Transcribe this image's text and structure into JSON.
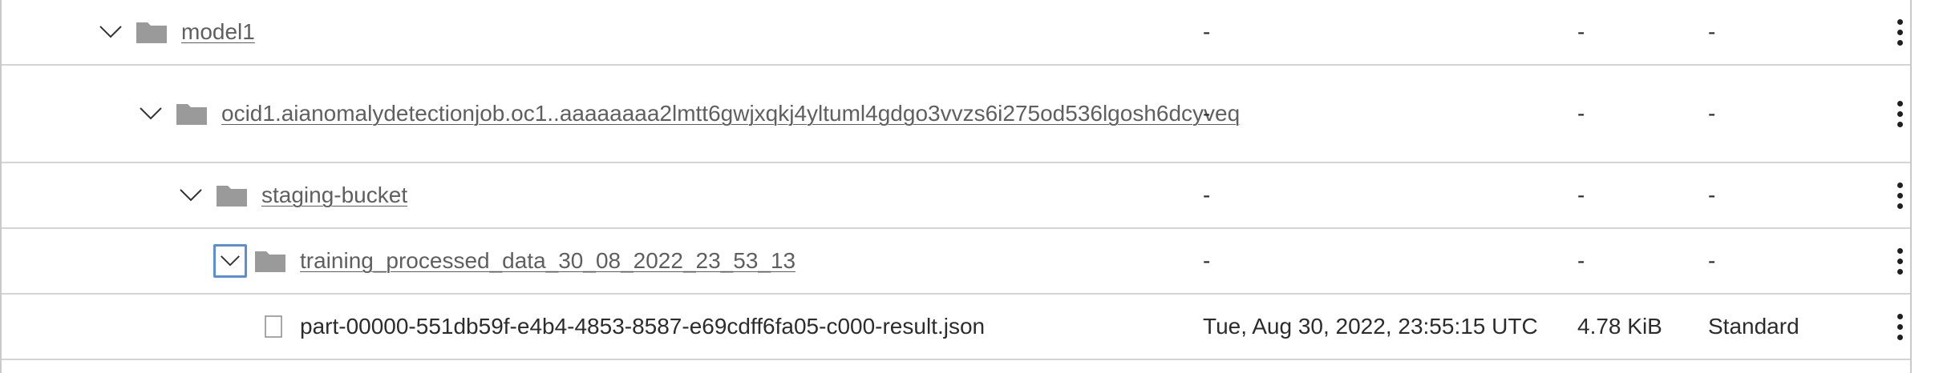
{
  "rows": [
    {
      "name": "model1",
      "type": "folder",
      "modified": "-",
      "size": "-",
      "tier": "-"
    },
    {
      "name": "ocid1.aianomalydetectionjob.oc1..aaaaaaaa2lmtt6gwjxqkj4yltuml4gdgo3vvzs6i275od536lgosh6dcyveq",
      "type": "folder",
      "modified": "-",
      "size": "-",
      "tier": "-"
    },
    {
      "name": "staging-bucket",
      "type": "folder",
      "modified": "-",
      "size": "-",
      "tier": "-"
    },
    {
      "name": "training_processed_data_30_08_2022_23_53_13",
      "type": "folder",
      "modified": "-",
      "size": "-",
      "tier": "-"
    },
    {
      "name": "part-00000-551db59f-e4b4-4853-8587-e69cdff6fa05-c000-result.json",
      "type": "file",
      "modified": "Tue, Aug 30, 2022, 23:55:15 UTC",
      "size": "4.78 KiB",
      "tier": "Standard"
    }
  ],
  "icons": {
    "expand": "chevron-down-icon",
    "folder": "folder-icon",
    "file": "file-icon",
    "actions": "kebab-menu-icon"
  },
  "colors": {
    "focus_ring": "#5b8fd4",
    "folder": "#9a9a9a",
    "link": "#5f5f5f",
    "border": "#d4d4d4"
  }
}
